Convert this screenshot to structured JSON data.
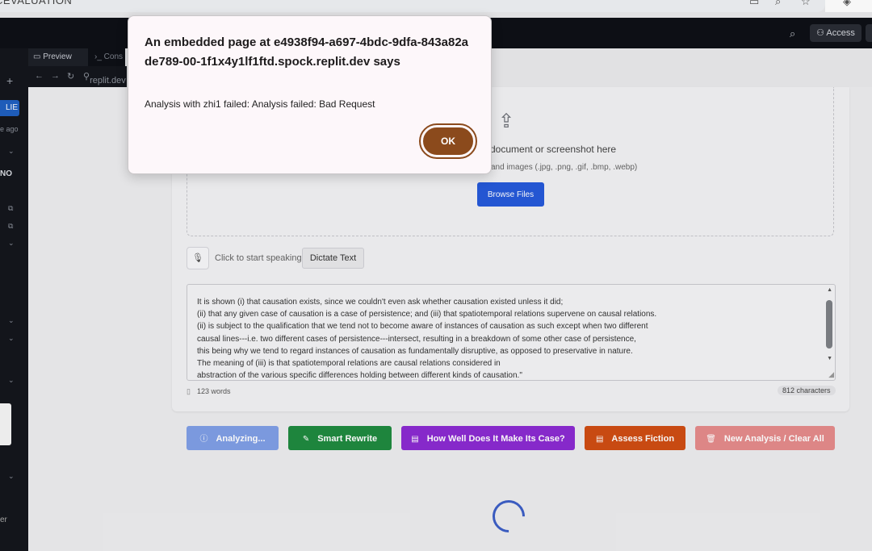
{
  "browser": {
    "url_fragment": "CEVALUATION",
    "icons": [
      "desktop-icon",
      "zoom-icon",
      "bookmark-star-icon",
      "extension-icon"
    ]
  },
  "ide": {
    "top_access_label": "Access",
    "tabs": {
      "preview": "Preview",
      "console": "Cons"
    },
    "nav_url": "replit.dev",
    "sidebar": {
      "pill": "LIE",
      "ago": "e ago",
      "label_no": "NO",
      "bottom_label": "er"
    }
  },
  "app": {
    "dropzone": {
      "title": "document or screenshot here",
      "subtitle": "and images (.jpg, .png, .gif, .bmp, .webp)",
      "browse_label": "Browse Files"
    },
    "speech": {
      "label": "Click to start speaking",
      "dictate_label": "Dictate Text"
    },
    "textarea_lines": [
      "It is shown (i) that causation exists, since we couldn't even ask whether causation existed unless it did;",
      "(ii) that any given case of causation is a case of persistence; and (iii) that spatiotemporal relations supervene on causal relations.",
      "(ii) is subject to the qualification that we tend not to become aware of instances of causation as such except when two different",
      "causal lines---i.e. two different cases of persistence---intersect, resulting in a breakdown of some other case of persistence,",
      "this being why we tend to regard instances of causation as fundamentally disruptive, as opposed to preservative in nature.",
      "The meaning of (iii) is that spatiotemporal relations are causal relations considered in",
      "abstraction of the various specific differences holding between different kinds of causation.\""
    ],
    "word_count": "123 words",
    "char_count": "812 characters",
    "actions": [
      {
        "label": "Analyzing...",
        "color": "#7f9ee6",
        "icon": "info-icon"
      },
      {
        "label": "Smart Rewrite",
        "color": "#1f8a3f",
        "icon": "rewrite-icon"
      },
      {
        "label": "How Well Does It Make Its Case?",
        "color": "#8b2bd1",
        "icon": "document-icon"
      },
      {
        "label": "Assess Fiction",
        "color": "#cf4d13",
        "icon": "document-icon"
      },
      {
        "label": "New Analysis / Clear All",
        "color": "#e58b8b",
        "icon": "trash-icon"
      }
    ]
  },
  "alert": {
    "title": "An embedded page at e4938f94-a697-4bdc-9dfa-843a82ade789-00-1f1x4y1lf1ftd.spock.replit.dev says",
    "message": "Analysis with zhi1 failed: Analysis failed: Bad Request",
    "ok_label": "OK",
    "accent": "#8b4a1c"
  }
}
